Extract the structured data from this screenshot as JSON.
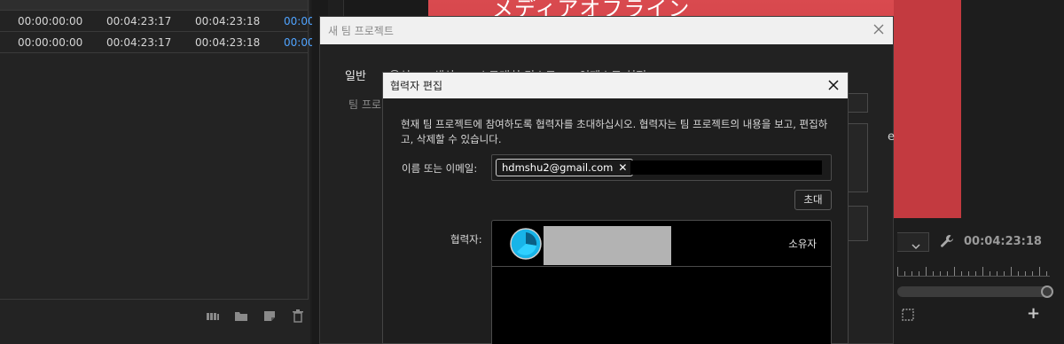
{
  "project_panel": {
    "rows": [
      {
        "c1": "00:00:00:00",
        "c2": "00:04:23:17",
        "c3": "00:04:23:18",
        "c4": "00:00"
      },
      {
        "c1": "00:00:00:00",
        "c2": "00:04:23:17",
        "c3": "00:04:23:18",
        "c4": "00:00"
      }
    ],
    "tool_icons": [
      "library-icon",
      "new-bin-icon",
      "new-item-icon",
      "trash-icon"
    ]
  },
  "program_monitor": {
    "title_text": "メディアオフライン",
    "timecode": "00:04:23:18",
    "accent_color": "#c8373d",
    "extra_glyph": "e"
  },
  "team_dialog": {
    "title": "새 팀 프로젝트",
    "tabs": [
      "일반",
      "음성",
      "색상",
      "스크래치 디스크",
      "인제스트 설정"
    ],
    "sub_label": "팀 프로"
  },
  "collab_dialog": {
    "title": "협력자 편집",
    "description": "현재 팀 프로젝트에 참여하도록 협력자를 초대하십시오. 협력자는 팀 프로젝트의 내용을 보고, 편집하고, 삭제할 수 있습니다.",
    "email_label": "이름 또는 이메일:",
    "email_chip": "hdmshu2@gmail.com",
    "email_input_value": "",
    "invite_button": "초대",
    "collaborators_label": "협력자:",
    "collaborators": [
      {
        "role": "소유자",
        "avatar_color": "#18b4e8"
      }
    ]
  }
}
